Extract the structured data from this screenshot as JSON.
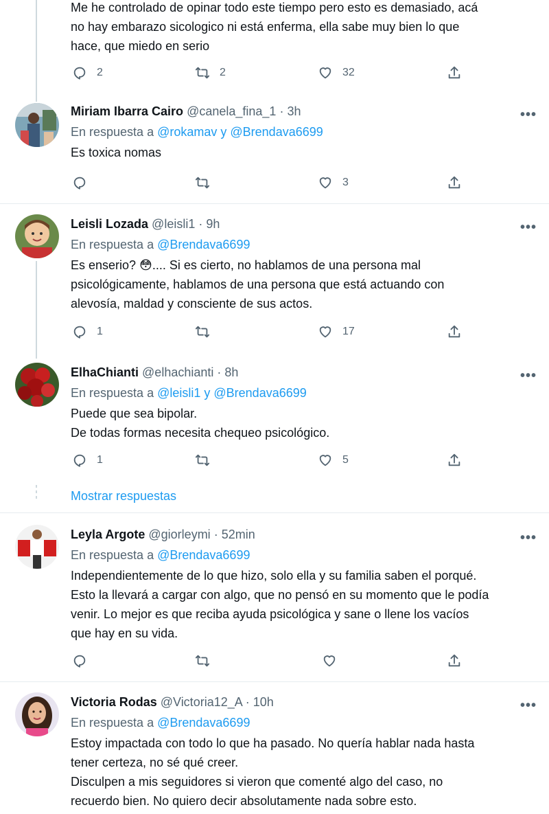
{
  "top_tweet": {
    "lines": [
      "Me he controlado de opinar todo este tiempo pero esto es demasiado, acá",
      "no hay embarazo sicologico ni está enferma, ella sabe muy bien lo que",
      "hace, que miedo en serio"
    ],
    "replies": "2",
    "retweets": "2",
    "likes": "32"
  },
  "tweets": [
    {
      "name": "Miriam Ibarra Cairo",
      "handle": "@canela_fina_1",
      "time": "3h",
      "reply_prefix": "En respuesta a ",
      "reply_mentions": "@rokamav y @Brendava6699",
      "lines": [
        "Es toxica nomas"
      ],
      "replies": "",
      "retweets": "",
      "likes": "3"
    },
    {
      "name": "Leisli Lozada",
      "handle": "@leisli1",
      "time": "9h",
      "reply_prefix": "En respuesta a ",
      "reply_mentions": "@Brendava6699",
      "lines": [
        "Es enserio? 😳.... Si es cierto, no hablamos de una persona mal",
        "psicológicamente, hablamos de una persona que está actuando con",
        "alevosía, maldad y consciente de sus actos."
      ],
      "replies": "1",
      "retweets": "",
      "likes": "17"
    },
    {
      "name": "ElhaChianti",
      "handle": "@elhachianti",
      "time": "8h",
      "reply_prefix": "En respuesta a ",
      "reply_mentions": "@leisli1 y @Brendava6699",
      "lines": [
        "Puede que sea bipolar.",
        "De todas formas necesita chequeo psicológico."
      ],
      "replies": "1",
      "retweets": "",
      "likes": "5"
    },
    {
      "name": "Leyla Argote",
      "handle": "@giorleymi",
      "time": "52min",
      "reply_prefix": "En respuesta a ",
      "reply_mentions": "@Brendava6699",
      "lines": [
        "Independientemente de lo que hizo, solo ella y su familia  saben el porqué.",
        "Esto la llevará a cargar con algo, que no pensó en su momento que le podía",
        "venir. Lo mejor es que reciba ayuda psicológica y sane o llene los vacíos",
        "que hay en su vida."
      ],
      "replies": "",
      "retweets": "",
      "likes": ""
    },
    {
      "name": "Victoria Rodas",
      "handle": "@Victoria12_A",
      "time": "10h",
      "reply_prefix": "En respuesta a ",
      "reply_mentions": "@Brendava6699",
      "lines": [
        "Estoy impactada con todo lo que ha pasado. No quería hablar nada hasta",
        "tener certeza, no sé qué creer.",
        "Disculpen a mis seguidores si vieron que comenté algo del caso, no",
        "recuerdo bien. No quiero decir absolutamente nada sobre esto."
      ],
      "replies": "",
      "retweets": "",
      "likes": ""
    }
  ],
  "show_replies_label": "Mostrar respuestas",
  "separator": "·",
  "more_label": "•••",
  "colors": {
    "accent": "#1d9bf0",
    "secondary_text": "#536471",
    "divider": "#e6ecf0"
  }
}
